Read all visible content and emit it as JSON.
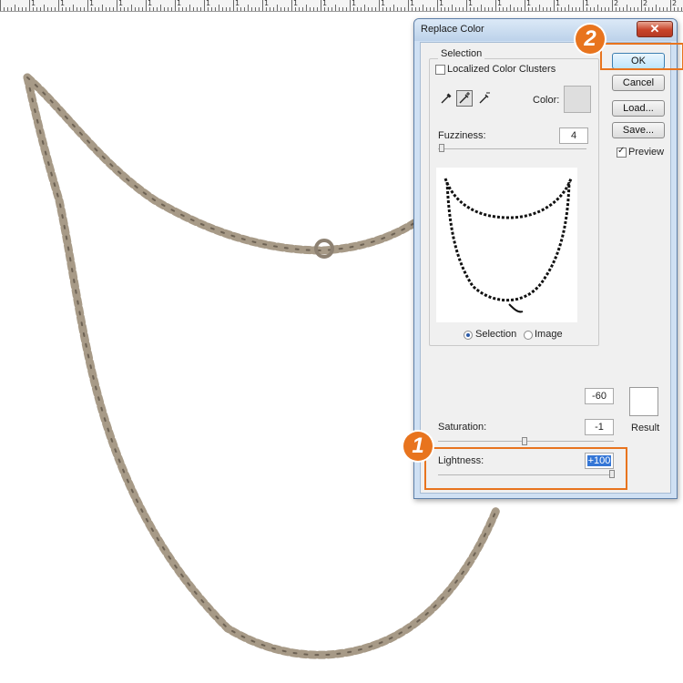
{
  "dialog": {
    "title": "Replace Color",
    "close_glyph": "✕",
    "selection_group": "Selection",
    "localized_color_clusters": "Localized Color Clusters",
    "localized_checked": false,
    "color_label": "Color:",
    "fuzziness_label": "Fuzziness:",
    "fuzziness_value": "4",
    "fuzziness_level": 4,
    "view_selection": "Selection",
    "view_image": "Image",
    "view_mode": "selection",
    "hue_value": "-60",
    "saturation_label": "Saturation:",
    "saturation_value": "-1",
    "lightness_label": "Lightness:",
    "lightness_value": "+100",
    "result_label": "Result",
    "buttons": {
      "ok": "OK",
      "cancel": "Cancel",
      "load": "Load...",
      "save": "Save..."
    },
    "preview_label": "Preview",
    "preview_checked": true
  },
  "callouts": [
    "1",
    "2"
  ],
  "ruler": [
    "1",
    "1",
    "1",
    "1",
    "1",
    "1",
    "1",
    "1",
    "1",
    "1",
    "1",
    "1",
    "1",
    "1",
    "1",
    "1",
    "1",
    "1",
    "1",
    "1",
    "2",
    "2",
    "2"
  ],
  "icons": [
    "eyedropper-icon",
    "eyedropper-plus-icon",
    "eyedropper-minus-icon",
    "close-icon"
  ],
  "colors": {
    "accent_orange": "#e8741e",
    "title_bar": "#bcd2ea",
    "selection_highlight": "#3476d6"
  }
}
